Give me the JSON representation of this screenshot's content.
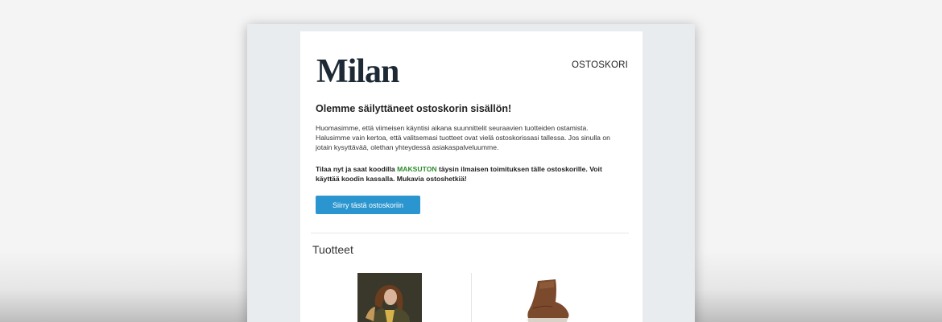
{
  "email": {
    "brand": "Milan",
    "cart_link": "OSTOSKORI",
    "headline": "Olemme säilyttäneet ostoskorin sisällön!",
    "body_lines": [
      "Huomasimme, että viimeisen käyntisi aikana suunnittelit seuraavien tuotteiden ostamista.",
      "Halusimme vain kertoa, että valitsemasi tuotteet ovat vielä ostoskorissasi tallessa. Jos sinulla on",
      "jotain kysyttävää, olethan yhteydessä asiakaspalveluumme."
    ],
    "offer_prefix": "Tilaa nyt ja saat koodilla ",
    "offer_code": "MAKSUTON",
    "offer_suffix": " täysin ilmaisen toimituksen tälle ostoskorille. Voit käyttää koodin kassalla. Mukavia ostoshetkiä!",
    "cta_label": "Siirry tästä ostoskoriin",
    "products_title": "Tuotteet",
    "products": [
      {
        "image": "jacket-model-photo"
      },
      {
        "image": "brown-boot-photo"
      }
    ],
    "colors": {
      "accent_button": "#2a95cf",
      "code_green": "#2a8a2a",
      "frame_bg": "#e8ecef"
    }
  }
}
